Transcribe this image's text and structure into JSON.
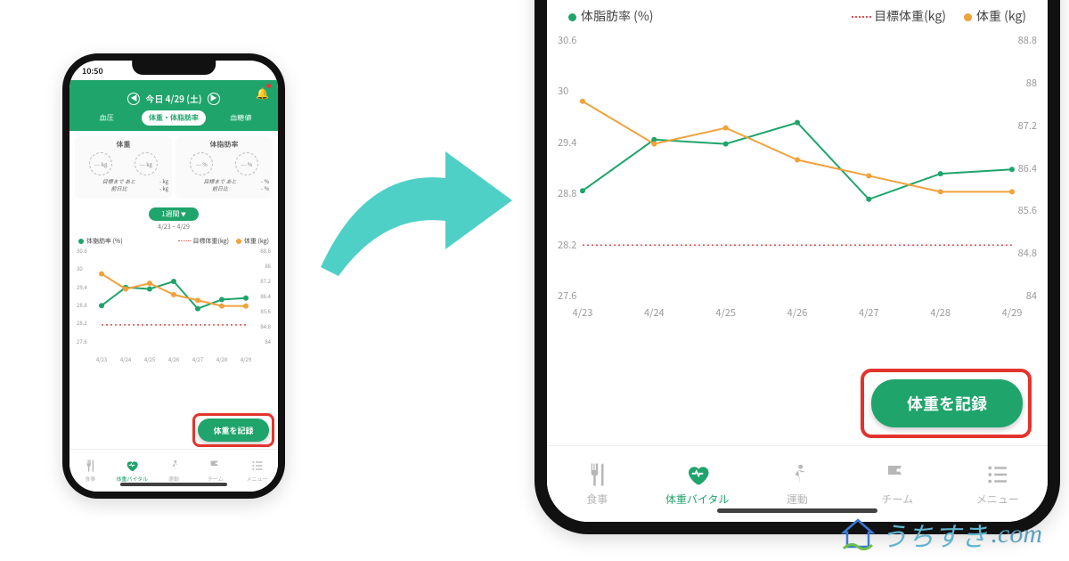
{
  "status": {
    "time": "10:50"
  },
  "header": {
    "date_label": "今日 4/29 (土)"
  },
  "tabs": {
    "blood_pressure": "血圧",
    "weight_bodyfat": "体重・体脂肪率",
    "blood_sugar": "血糖値",
    "active_index": 1
  },
  "cards": {
    "weight": {
      "title": "体重",
      "dial1": "--- kg",
      "dial2": "--- kg",
      "goal_label": "目標まで あと",
      "goal_value": "- kg",
      "prev_label": "前日比",
      "prev_value": "- kg"
    },
    "bodyfat": {
      "title": "体脂肪率",
      "dial1": "--- %",
      "dial2": "--- %",
      "goal_label": "目標まで あと",
      "goal_value": "- %",
      "prev_label": "前日比",
      "prev_value": "- %"
    }
  },
  "period": {
    "pill": "1週間",
    "range": "4/23 ~ 4/29"
  },
  "legend": {
    "bodyfat": "体脂肪率 (%)",
    "goal": "目標体重(kg)",
    "weight": "体重 (kg)"
  },
  "chart_data": {
    "type": "line",
    "x": [
      "4/23",
      "4/24",
      "4/25",
      "4/26",
      "4/27",
      "4/28",
      "4/29"
    ],
    "y_left": {
      "label": "体脂肪率 (%)",
      "ticks": [
        27.6,
        28.2,
        28.8,
        29.4,
        30,
        30.6
      ]
    },
    "y_right": {
      "label": "体重 (kg)",
      "ticks": [
        84,
        84.8,
        85.6,
        86.4,
        87.2,
        88,
        88.8
      ]
    },
    "series": [
      {
        "name": "体脂肪率 (%)",
        "axis": "left",
        "color": "#1fa46b",
        "values": [
          28.8,
          29.4,
          29.35,
          29.6,
          28.7,
          29.0,
          29.05
        ]
      },
      {
        "name": "体重 (kg)",
        "axis": "right",
        "color": "#f0a23c",
        "values": [
          87.6,
          86.8,
          87.1,
          86.5,
          86.2,
          85.9,
          85.9
        ]
      }
    ],
    "goal_weight": 84.9
  },
  "fab": {
    "label": "体重を記録"
  },
  "nav": {
    "items": [
      {
        "key": "meal",
        "label": "食事"
      },
      {
        "key": "vital",
        "label": "体重バイタル",
        "active": true
      },
      {
        "key": "exercise",
        "label": "運動"
      },
      {
        "key": "team",
        "label": "チーム"
      },
      {
        "key": "menu",
        "label": "メニュー"
      }
    ]
  },
  "watermark": {
    "text": "うちすき",
    "suffix": ".com"
  }
}
